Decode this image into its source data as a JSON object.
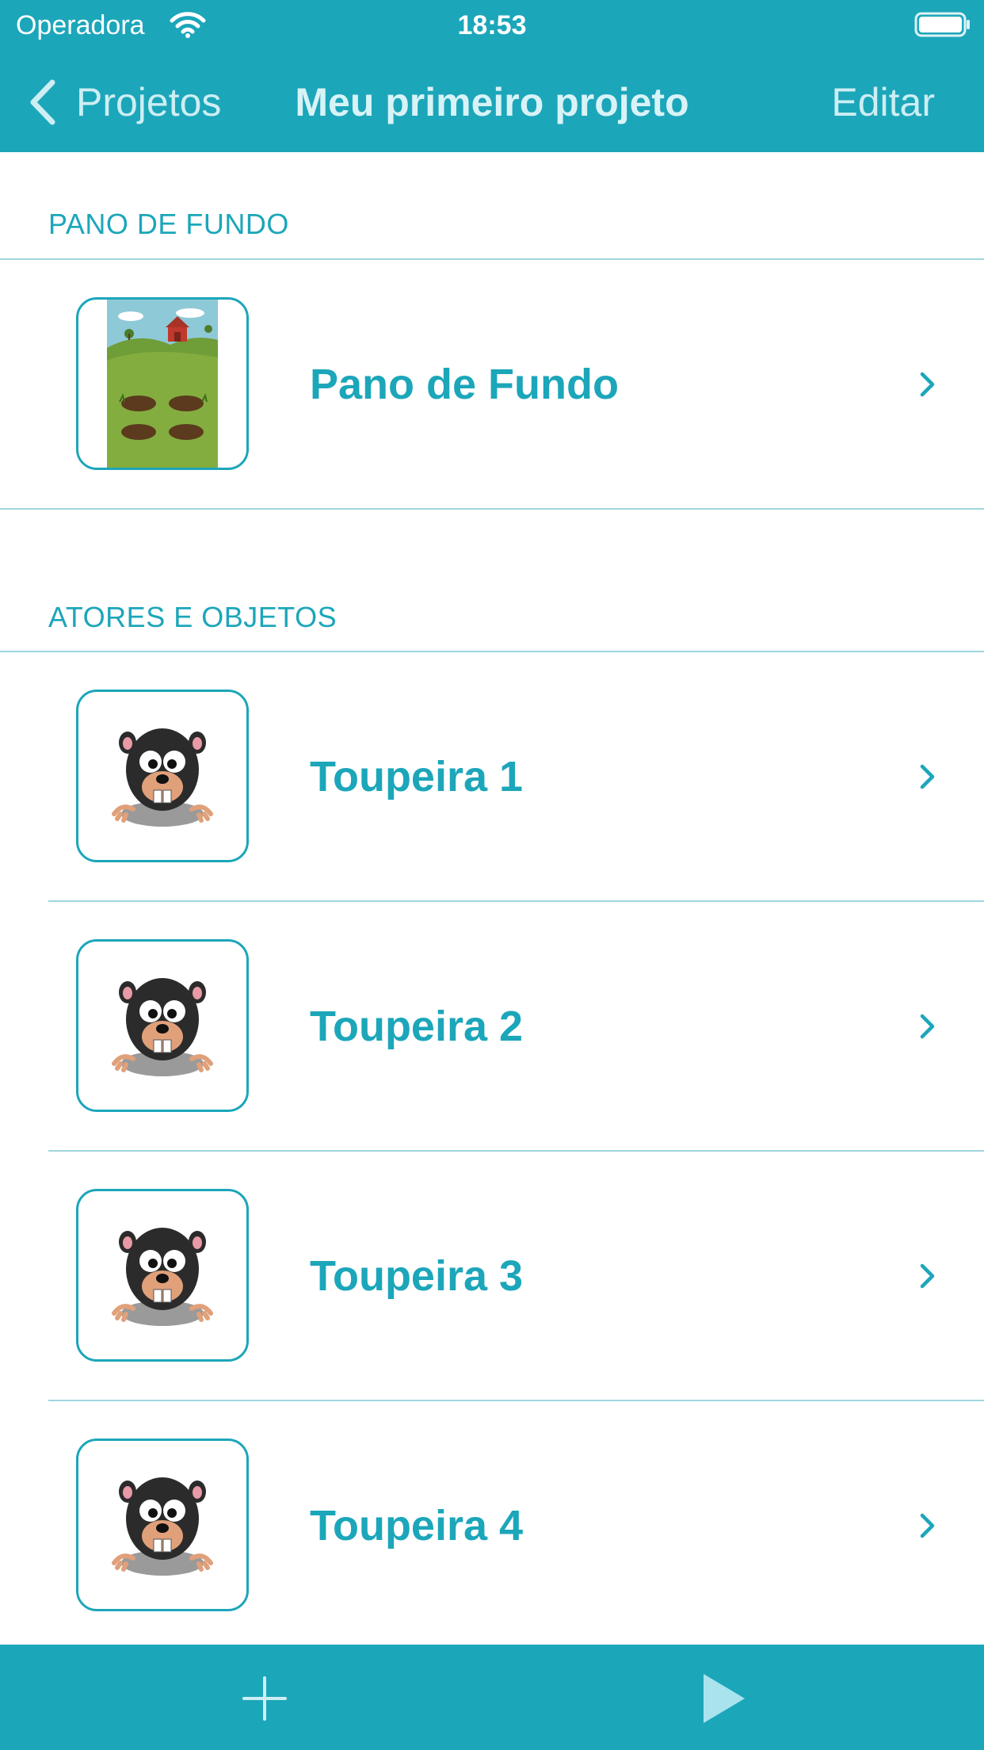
{
  "status_bar": {
    "carrier": "Operadora",
    "time": "18:53",
    "icons": [
      "wifi-icon",
      "battery-icon"
    ]
  },
  "nav": {
    "back_label": "Projetos",
    "title": "Meu primeiro projeto",
    "edit_label": "Editar"
  },
  "sections": {
    "background": {
      "header": "PANO DE FUNDO",
      "items": [
        {
          "label": "Pano de Fundo",
          "thumbnail": "farm-background-thumbnail"
        }
      ]
    },
    "actors": {
      "header": "ATORES E OBJETOS",
      "items": [
        {
          "label": "Toupeira 1",
          "thumbnail": "mole-thumbnail"
        },
        {
          "label": "Toupeira 2",
          "thumbnail": "mole-thumbnail"
        },
        {
          "label": "Toupeira 3",
          "thumbnail": "mole-thumbnail"
        },
        {
          "label": "Toupeira 4",
          "thumbnail": "mole-thumbnail"
        }
      ]
    }
  },
  "toolbar": {
    "icons": [
      "plus-icon",
      "play-icon"
    ]
  },
  "colors": {
    "accent": "#1ca6ba",
    "separator": "#9ed6de",
    "background": "#ffffff"
  }
}
